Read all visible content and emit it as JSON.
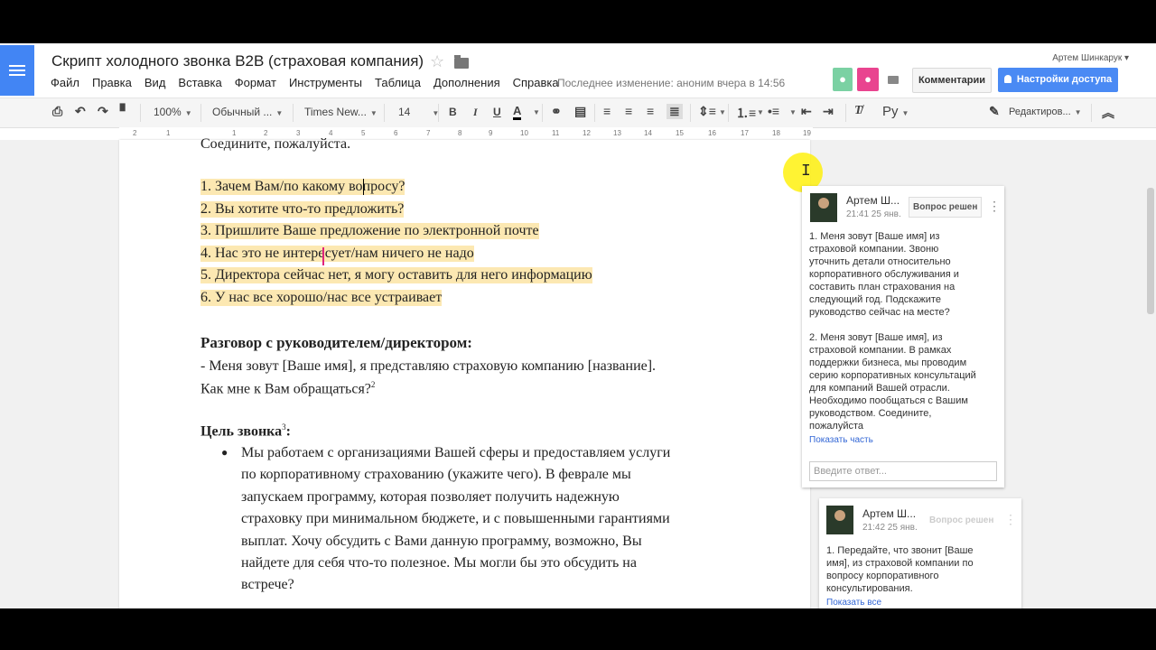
{
  "doc": {
    "title": "Скрипт холодного звонка B2B (страховая компания)",
    "last_edit": "Последнее изменение: аноним вчера в 14:56"
  },
  "user": {
    "name": "Артем Шинкарук ▾"
  },
  "menu": [
    "Файл",
    "Правка",
    "Вид",
    "Вставка",
    "Формат",
    "Инструменты",
    "Таблица",
    "Дополнения",
    "Справка"
  ],
  "header_buttons": {
    "comments": "Комментарии",
    "share": "Настройки доступа"
  },
  "toolbar": {
    "zoom": "100%",
    "style": "Обычный ...",
    "font": "Times New...",
    "size": "14",
    "bold": "B",
    "italic": "I",
    "underline": "U",
    "text_color": "A",
    "input_lang": "Ру",
    "mode": "Редактиров..."
  },
  "ruler": [
    "2",
    "1",
    "1",
    "2",
    "3",
    "4",
    "5",
    "6",
    "7",
    "8",
    "9",
    "10",
    "11",
    "12",
    "13",
    "14",
    "15",
    "16",
    "17",
    "18",
    "19"
  ],
  "content": {
    "top_partial": "Соедините, пожалуйста.",
    "list": [
      "1. Зачем Вам/по какому вопросу?",
      "2. Вы хотите что-то предложить?",
      "3. Пришлите Ваше предложение по электронной почте",
      "4. Нас это не интересует/нам ничего не надо",
      "5. Директора сейчас нет, я могу оставить для него информацию",
      "6. У нас все хорошо/нас все устраивает"
    ],
    "heading1": "Разговор с руководителем/директором:",
    "para1_line1": "-  Меня зовут [Ваше имя], я представляю страховую компанию [название].",
    "para1_line2": "Как мне к Вам обращаться?",
    "sup2": "2",
    "heading2": "Цель звонка",
    "sup3": "3",
    "heading2_colon": ":",
    "bullet_char": "●",
    "bullet_lines": [
      "Мы работаем с организациями Вашей сферы и предоставляем услуги",
      "по корпоративному страхованию (укажите чего). В феврале мы",
      "запускаем программу, которая позволяет получить надежную",
      "страховку при минимальном бюджете, и с повышенными гарантиями",
      "выплат. Хочу обсудить с Вами данную программу, возможно, Вы",
      "найдете для себя что-то полезное. Мы могли бы это обсудить на",
      "встрече?"
    ]
  },
  "comments": [
    {
      "author": "Артем Ш...",
      "time": "21:41 25 янв.",
      "resolve": "Вопрос решен",
      "body": [
        "1. Меня зовут [Ваше имя] из",
        "страховой компании. Звоню",
        "уточнить детали относительно",
        "корпоративного обслуживания и",
        "составить план страхования на",
        "следующий год. Подскажите",
        "руководство сейчас на месте?",
        "",
        "2. Меня зовут [Ваше имя], из",
        "страховой компании. В рамках",
        "поддержки бизнеса, мы проводим",
        "серию корпоративных консультаций",
        "для компаний Вашей отрасли.",
        "Необходимо пообщаться с Вашим",
        "руководством. Соедините,",
        "пожалуйста"
      ],
      "link": "Показать часть",
      "reply_placeholder": "Введите ответ..."
    },
    {
      "author": "Артем Ш...",
      "time": "21:42 25 янв.",
      "resolve": "Вопрос решен",
      "body": [
        "1. Передайте, что звонит [Ваше",
        "имя], из страховой компании по",
        "вопросу корпоративного",
        "консультирования."
      ],
      "link": "Показать все"
    }
  ],
  "colors": {
    "highlight": "#fce8b2",
    "share": "#4a8af4",
    "logo": "#4285f4"
  }
}
